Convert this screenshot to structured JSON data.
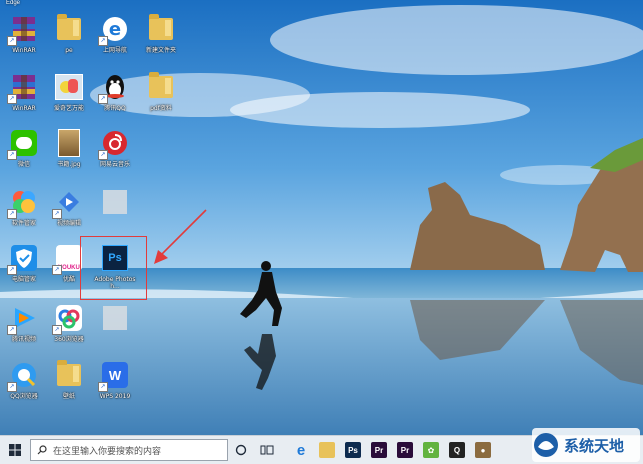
{
  "desktop": {
    "top_label": "Edge",
    "icons": [
      {
        "name": "icon-winrar",
        "label": "WinRAR",
        "kind": "winrar"
      },
      {
        "name": "icon-folder-1",
        "label": "pe",
        "kind": "folder"
      },
      {
        "name": "icon-ie",
        "label": "上网导航",
        "kind": "ie"
      },
      {
        "name": "icon-folder-2",
        "label": "新建文件夹",
        "kind": "folder"
      },
      {
        "name": "icon-winrar-2",
        "label": "WinRAR",
        "kind": "winrar"
      },
      {
        "name": "icon-pokemon",
        "label": "爱奇艺万能",
        "kind": "image"
      },
      {
        "name": "icon-qq",
        "label": "腾讯QQ",
        "kind": "qq"
      },
      {
        "name": "icon-pdf-folder",
        "label": "pdf资料",
        "kind": "folder"
      },
      {
        "name": "icon-wechat",
        "label": "微信",
        "kind": "wechat"
      },
      {
        "name": "icon-book-image",
        "label": "书籍.jpg",
        "kind": "book"
      },
      {
        "name": "icon-netease-music",
        "label": "网易云音乐",
        "kind": "netease"
      },
      {
        "name": "icon-colorful",
        "label": "软件管家",
        "kind": "colorful"
      },
      {
        "name": "icon-video-app",
        "label": "视频编辑",
        "kind": "video"
      },
      {
        "name": "icon-blurred",
        "label": "",
        "kind": "blurred"
      },
      {
        "name": "icon-security",
        "label": "电脑管家",
        "kind": "shield"
      },
      {
        "name": "icon-youku",
        "label": "优酷",
        "kind": "youku"
      },
      {
        "name": "icon-photoshop",
        "label": "Adobe Photosh...",
        "kind": "ps"
      },
      {
        "name": "icon-tencent-video",
        "label": "腾讯视频",
        "kind": "tvideo"
      },
      {
        "name": "icon-360",
        "label": "360浏览器",
        "kind": "ring"
      },
      {
        "name": "icon-blurred-2",
        "label": "",
        "kind": "blurred"
      },
      {
        "name": "icon-browser-q",
        "label": "QQ浏览器",
        "kind": "qbrowser"
      },
      {
        "name": "icon-folder-3",
        "label": "壁纸",
        "kind": "folder"
      },
      {
        "name": "icon-wps",
        "label": "WPS 2019",
        "kind": "wps"
      }
    ]
  },
  "taskbar": {
    "search_placeholder": "在这里输入你要搜索的内容",
    "apps": [
      {
        "name": "taskbar-edge",
        "glyph": "e",
        "color": "#1f7ad8"
      },
      {
        "name": "taskbar-folder",
        "glyph": "",
        "color": "#e8c25a"
      },
      {
        "name": "taskbar-ps",
        "glyph": "Ps",
        "color": "#0d2b4f"
      },
      {
        "name": "taskbar-pr",
        "glyph": "Pr",
        "color": "#2a0c3a"
      },
      {
        "name": "taskbar-pr-2",
        "glyph": "Pr",
        "color": "#2a0c3a"
      },
      {
        "name": "taskbar-leaf",
        "glyph": "✿",
        "color": "#62b33f"
      },
      {
        "name": "taskbar-qq",
        "glyph": "Q",
        "color": "#222222"
      },
      {
        "name": "taskbar-avatar",
        "glyph": "●",
        "color": "#8b6b3f"
      }
    ]
  },
  "watermark": {
    "text": "系统天地"
  },
  "colors": {
    "accent": "#1f7ad8",
    "selection": "#e23b3b"
  }
}
